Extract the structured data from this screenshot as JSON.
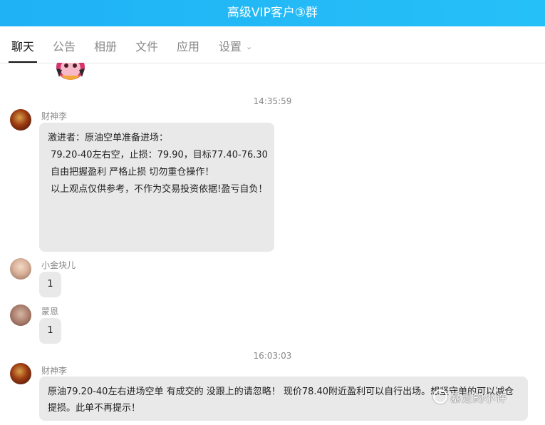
{
  "window": {
    "title": "高级VIP客户③群"
  },
  "tabs": [
    {
      "label": "聊天",
      "active": true
    },
    {
      "label": "公告"
    },
    {
      "label": "相册"
    },
    {
      "label": "文件"
    },
    {
      "label": "应用"
    },
    {
      "label": "设置"
    }
  ],
  "messages": [
    {
      "time": "14:35:59",
      "sender": "财神李",
      "avatar": "caishenli-avatar",
      "lines": [
        "激进者：原油空单准备进场：",
        "",
        " 79.20-40左右空，止损：79.90，目标77.40-76.30",
        "",
        " 自由把握盈利 严格止损 切勿重仓操作！",
        "",
        " 以上观点仅供参考，不作为交易投资依据!盈亏自负！"
      ]
    },
    {
      "sender": "小金块儿",
      "avatar": "xiaojinkuaier-avatar",
      "text": "1"
    },
    {
      "sender": "蒙恩",
      "avatar": "mengen-avatar",
      "text": "1"
    },
    {
      "time": "16:03:03",
      "sender": "财神李",
      "avatar": "caishenli-avatar",
      "text": "原油79.20-40左右进场空单 有成交的 没跟上的请忽略！ 现价78.40附近盈利可以自行出场。想坚守单的可以减仓提损。此单不再提示！"
    }
  ],
  "watermark": "暴走的小许",
  "colors": {
    "titlebar": "#1fb2f5",
    "bubble": "#e9e9ea",
    "active_tab": "#111111"
  }
}
